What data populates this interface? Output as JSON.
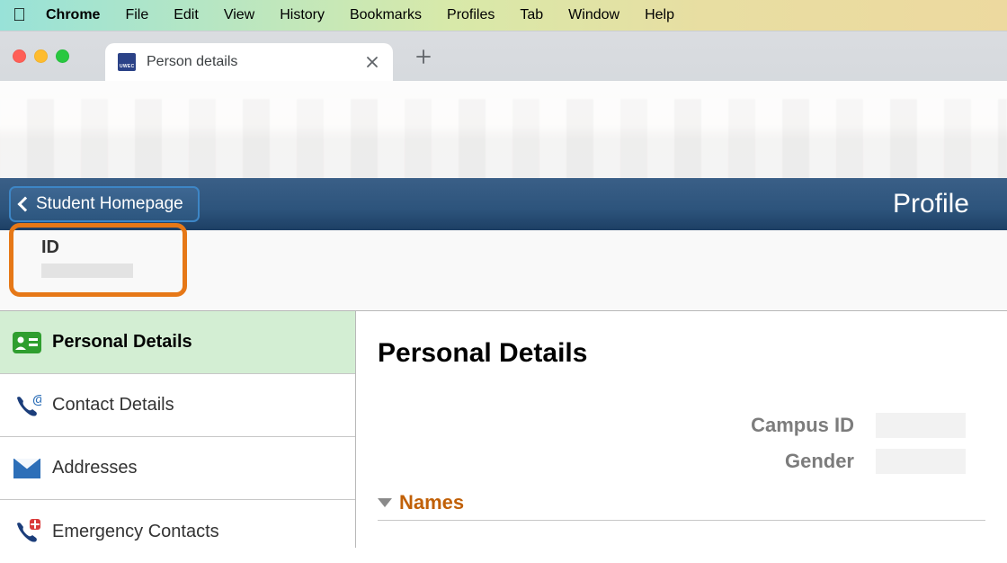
{
  "mac_menu": {
    "app": "Chrome",
    "items": [
      "File",
      "Edit",
      "View",
      "History",
      "Bookmarks",
      "Profiles",
      "Tab",
      "Window",
      "Help"
    ]
  },
  "chrome": {
    "tab_title": "Person details",
    "favicon_text": "UWEC"
  },
  "app_header": {
    "back_label": "Student Homepage",
    "title": "Profile"
  },
  "id_panel": {
    "label": "ID",
    "value": ""
  },
  "sidebar": {
    "items": [
      {
        "label": "Personal Details",
        "icon": "id-card",
        "active": true
      },
      {
        "label": "Contact Details",
        "icon": "phone-at",
        "active": false
      },
      {
        "label": "Addresses",
        "icon": "envelope",
        "active": false
      },
      {
        "label": "Emergency Contacts",
        "icon": "phone-plus",
        "active": false
      }
    ]
  },
  "content": {
    "heading": "Personal Details",
    "fields": [
      {
        "label": "Campus ID",
        "value": ""
      },
      {
        "label": "Gender",
        "value": ""
      }
    ],
    "section": {
      "title": "Names"
    }
  }
}
